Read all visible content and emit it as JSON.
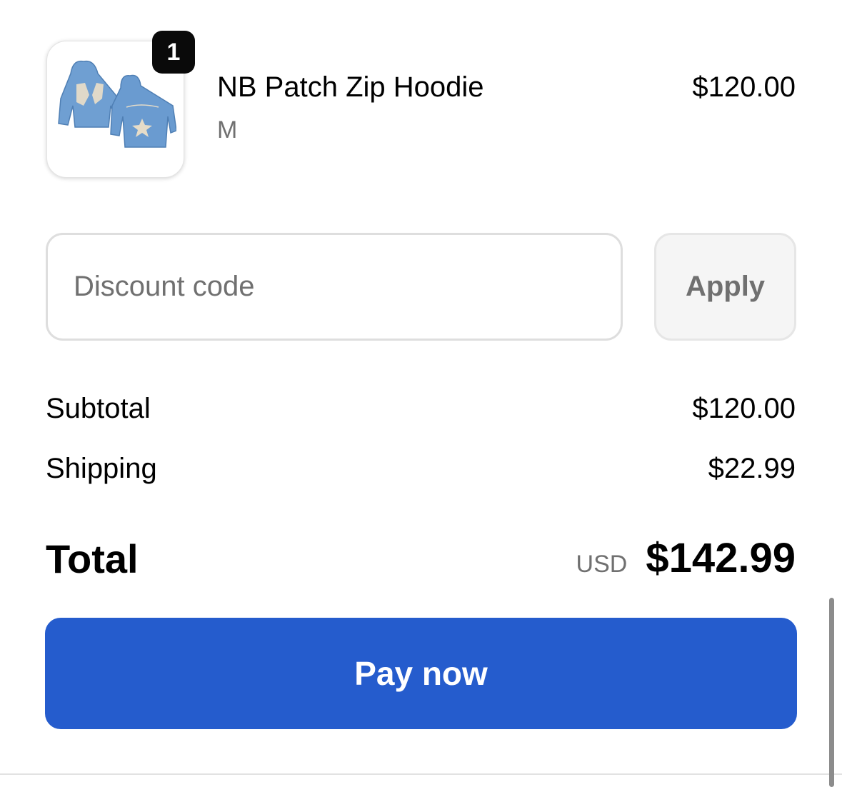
{
  "product": {
    "quantity_badge": "1",
    "name": "NB Patch Zip Hoodie",
    "variant": "M",
    "price": "$120.00",
    "image_icon": "hoodie-thumbnail"
  },
  "discount": {
    "placeholder": "Discount code",
    "value": "",
    "apply_label": "Apply"
  },
  "summary": {
    "subtotal_label": "Subtotal",
    "subtotal_value": "$120.00",
    "shipping_label": "Shipping",
    "shipping_value": "$22.99",
    "total_label": "Total",
    "currency": "USD",
    "total_value": "$142.99"
  },
  "actions": {
    "pay_label": "Pay now"
  },
  "colors": {
    "primary_button": "#255ccd",
    "muted_text": "#707070"
  }
}
